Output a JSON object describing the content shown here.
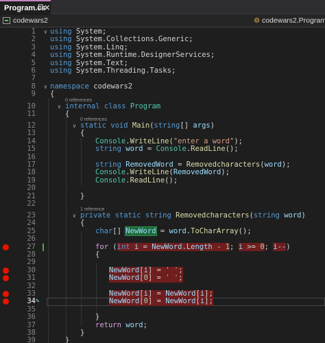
{
  "tab": {
    "title": "Program.cs",
    "pin": "⊡",
    "close": "✕"
  },
  "nav": {
    "project": "codewars2",
    "cls": "codewars2.Program",
    "cls_icon": "⚙"
  },
  "refs": {
    "zero": "0 references",
    "one": "1 reference"
  },
  "lines": [
    {
      "n": "1",
      "t": "using System;"
    },
    {
      "n": "2",
      "t": "using System.Collections.Generic;"
    },
    {
      "n": "3",
      "t": "using System.Linq;"
    },
    {
      "n": "4",
      "t": "using System.Runtime.DesignerServices;"
    },
    {
      "n": "5",
      "t": "using System.Text;"
    },
    {
      "n": "6",
      "t": "using System.Threading.Tasks;"
    },
    {
      "n": "7",
      "t": ""
    },
    {
      "n": "8",
      "t": "namespace codewars2"
    },
    {
      "n": "9",
      "t": "{"
    },
    {
      "n": "10",
      "t": "internal class Program"
    },
    {
      "n": "11",
      "t": "{"
    },
    {
      "n": "12",
      "t": "static void Main(string[] args)"
    },
    {
      "n": "13",
      "t": "{"
    },
    {
      "n": "14",
      "t": "Console.WriteLine(\"enter a word\");"
    },
    {
      "n": "15",
      "t": "string word = Console.ReadLine();"
    },
    {
      "n": "16",
      "t": ""
    },
    {
      "n": "17",
      "t": "string RemovedWord = Removedcharacters(word);"
    },
    {
      "n": "18",
      "t": "Console.WriteLine(RemovedWord);"
    },
    {
      "n": "19",
      "t": "Console.ReadLine();"
    },
    {
      "n": "20",
      "t": ""
    },
    {
      "n": "21",
      "t": "}"
    },
    {
      "n": "22",
      "t": ""
    },
    {
      "n": "23",
      "t": "private static string Removedcharacters(string word)"
    },
    {
      "n": "24",
      "t": "{"
    },
    {
      "n": "25",
      "t": "char[] NewWord = word.ToCharArray();"
    },
    {
      "n": "26",
      "t": ""
    },
    {
      "n": "27",
      "t": "for (int i = NewWord.Length - 1; i >= 0; i--)"
    },
    {
      "n": "28",
      "t": "{"
    },
    {
      "n": "29",
      "t": ""
    },
    {
      "n": "30",
      "t": "NewWord[i] = ' ';"
    },
    {
      "n": "31",
      "t": "NewWord[0] = ' ';"
    },
    {
      "n": "32",
      "t": ""
    },
    {
      "n": "33",
      "t": "NewWord[i] = NewWord[i];"
    },
    {
      "n": "34",
      "t": "NewWord[0] = NewWord[i];"
    },
    {
      "n": "35",
      "t": ""
    },
    {
      "n": "36",
      "t": "}"
    },
    {
      "n": "37",
      "t": "return word;"
    },
    {
      "n": "38",
      "t": "}"
    },
    {
      "n": "39",
      "t": "}"
    }
  ]
}
